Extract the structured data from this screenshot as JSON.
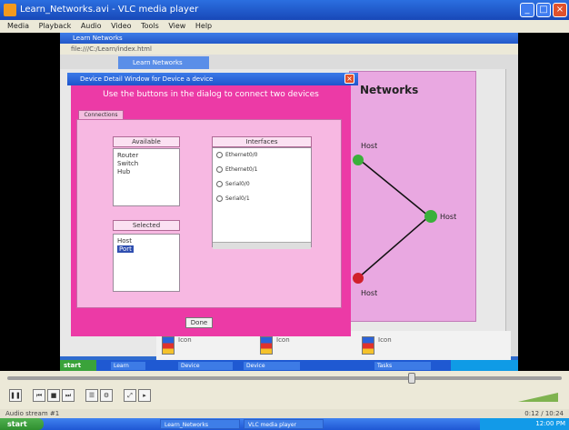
{
  "player": {
    "title": "Learn_Networks.avi - VLC media player",
    "menu": [
      "Media",
      "Playback",
      "Audio",
      "Video",
      "Tools",
      "View",
      "Help"
    ],
    "status_left": "Audio stream #1",
    "status_right": "0:12 / 10:24"
  },
  "browser": {
    "title": "Learn Networks",
    "address": "file:///C:/Learn/index.html",
    "tab": "Learn Networks"
  },
  "dialog": {
    "title": "Device Detail Window for Device a device",
    "instruction": "Use the buttons in the dialog to connect two devices",
    "tab": "Connections",
    "list1_header": "Available",
    "list1_items": [
      "Router",
      "Switch",
      "Hub"
    ],
    "list2_header": "Selected",
    "list2_items": [
      "Host",
      "Port"
    ],
    "radio_header": "Interfaces",
    "radio_items": [
      "Ethernet0/0",
      "Ethernet0/1",
      "Serial0/0",
      "Serial0/1"
    ],
    "ok": "Done"
  },
  "network": {
    "title": "Networks",
    "nodes": [
      "Host",
      "Host",
      "Host"
    ],
    "node_colors": [
      "#3ab03a",
      "#3ab03a",
      "#d0202a"
    ]
  },
  "inner_strip": {
    "items": [
      {
        "label": "Icon"
      },
      {
        "label": "Icon"
      },
      {
        "label": "Icon"
      }
    ]
  },
  "inner_taskbar": {
    "start": "start",
    "tasks": [
      "Learn",
      "Device",
      "Device",
      "Tasks"
    ]
  },
  "taskbar": {
    "start": "start",
    "tasks": [
      "Learn_Networks",
      "VLC media player"
    ],
    "tray_time": "12:00 PM"
  },
  "controls": {
    "buttons": [
      "pause",
      "prev",
      "stop",
      "next",
      "playlist",
      "ext",
      "fullscreen"
    ],
    "volume_percent": 100,
    "position_fraction": 0.73
  }
}
